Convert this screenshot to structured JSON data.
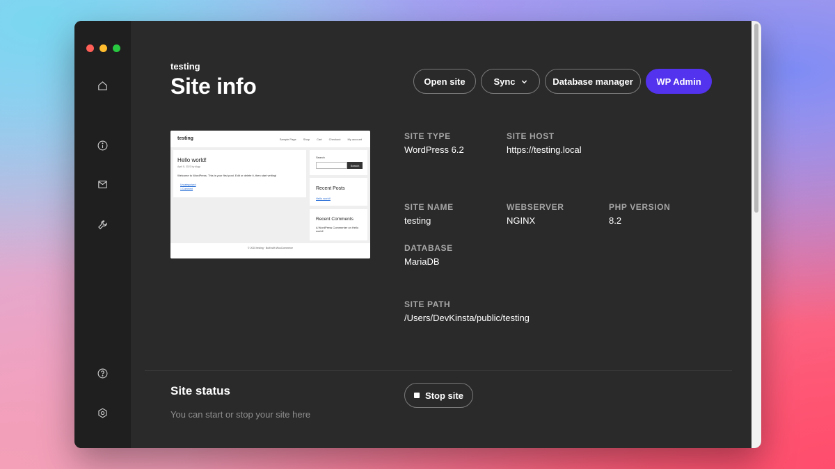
{
  "header": {
    "site_name": "testing",
    "title": "Site info"
  },
  "actions": {
    "open_site": "Open site",
    "sync": "Sync",
    "database_manager": "Database manager",
    "wp_admin": "WP Admin"
  },
  "sidebar": {
    "icons": [
      "home-icon",
      "info-icon",
      "mail-icon",
      "wrench-icon",
      "help-icon",
      "settings-icon"
    ]
  },
  "preview": {
    "brand": "testing",
    "nav": [
      "Sample Page",
      "Shop",
      "Cart",
      "Checkout",
      "My account"
    ],
    "post_title": "Hello world!",
    "post_meta": "April 5, 2023 by dkgp",
    "post_body": "Welcome to WordPress. This is your first post. Edit or delete it, then start writing!",
    "post_category": "Uncategorized",
    "post_comments": "1 Comment",
    "search_label": "Search",
    "search_button": "Search",
    "recent_posts_title": "Recent Posts",
    "recent_posts_item": "Hello world!",
    "recent_comments_title": "Recent Comments",
    "recent_comments_item": "A WordPress Commenter on Hello world!",
    "footer": "© 2023 testing · Built with WooCommerce"
  },
  "info": {
    "site_type_label": "SITE TYPE",
    "site_type_value": "WordPress 6.2",
    "site_host_label": "SITE HOST",
    "site_host_value": "https://testing.local",
    "site_name_label": "SITE NAME",
    "site_name_value": "testing",
    "webserver_label": "WEBSERVER",
    "webserver_value": "NGINX",
    "php_label": "PHP VERSION",
    "php_value": "8.2",
    "database_label": "DATABASE",
    "database_value": "MariaDB",
    "site_path_label": "SITE PATH",
    "site_path_value": "/Users/DevKinsta/public/testing"
  },
  "status": {
    "title": "Site status",
    "description": "You can start or stop your site here",
    "stop_button": "Stop site"
  },
  "colors": {
    "accent": "#5333ed",
    "window_bg": "#2a2a2a",
    "sidebar_bg": "#1f1f1f"
  }
}
